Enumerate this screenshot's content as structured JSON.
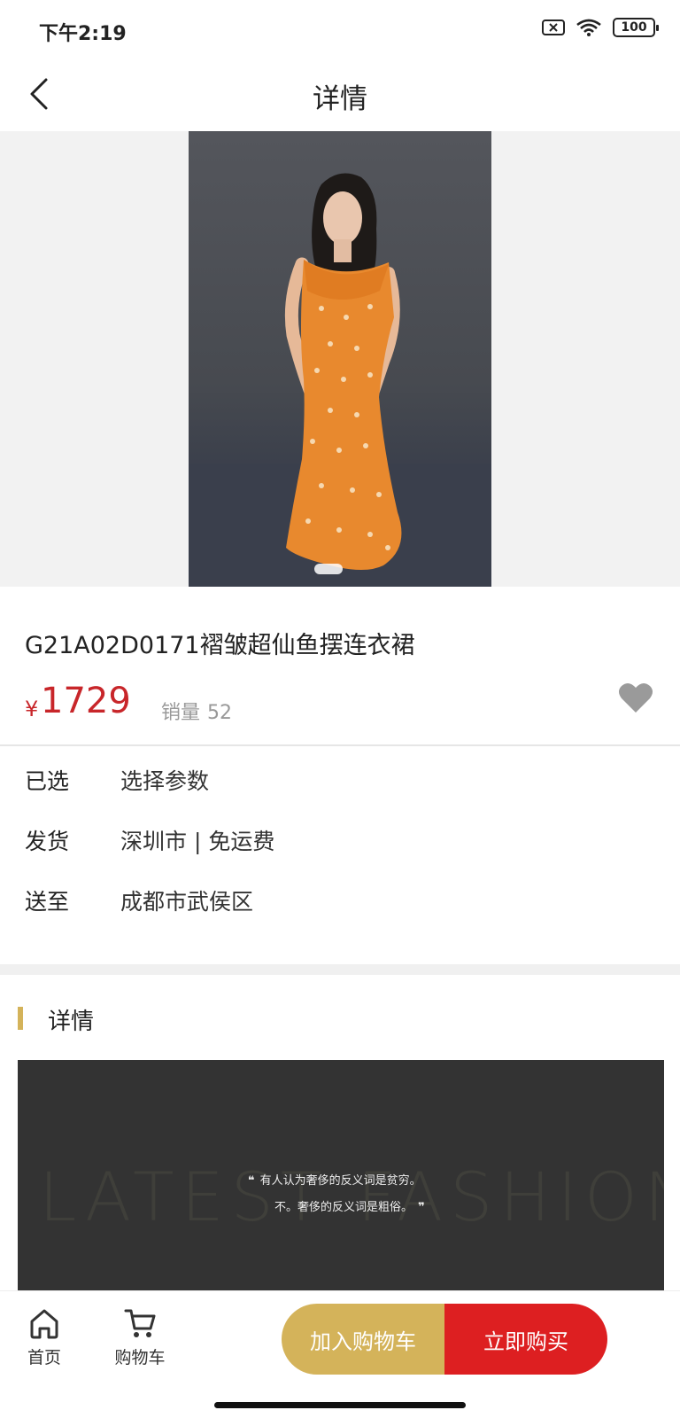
{
  "status_bar": {
    "time": "下午2:19",
    "battery": "100"
  },
  "navbar": {
    "title": "详情"
  },
  "product": {
    "name": "G21A02D0171褶皱超仙鱼摆连衣裙",
    "currency": "¥",
    "price": "1729",
    "sales_label": "销量",
    "sales_count": "52"
  },
  "specs": [
    {
      "key": "已选",
      "value": "选择参数"
    },
    {
      "key": "发货",
      "value": "深圳市 | 免运费"
    },
    {
      "key": "送至",
      "value": "成都市武侯区"
    }
  ],
  "detail_section": {
    "title": "详情",
    "banner_bg_text": "LATEST FASHION",
    "quote_line1": "有人认为奢侈的反义词是贫穷。",
    "quote_line2": "不。奢侈的反义词是粗俗。"
  },
  "bottom_bar": {
    "home_label": "首页",
    "cart_label": "购物车",
    "add_to_cart": "加入购物车",
    "buy_now": "立即购买"
  },
  "colors": {
    "accent_gold": "#d4b35a",
    "buy_red": "#dd1f21",
    "price_red": "#c8262a"
  }
}
